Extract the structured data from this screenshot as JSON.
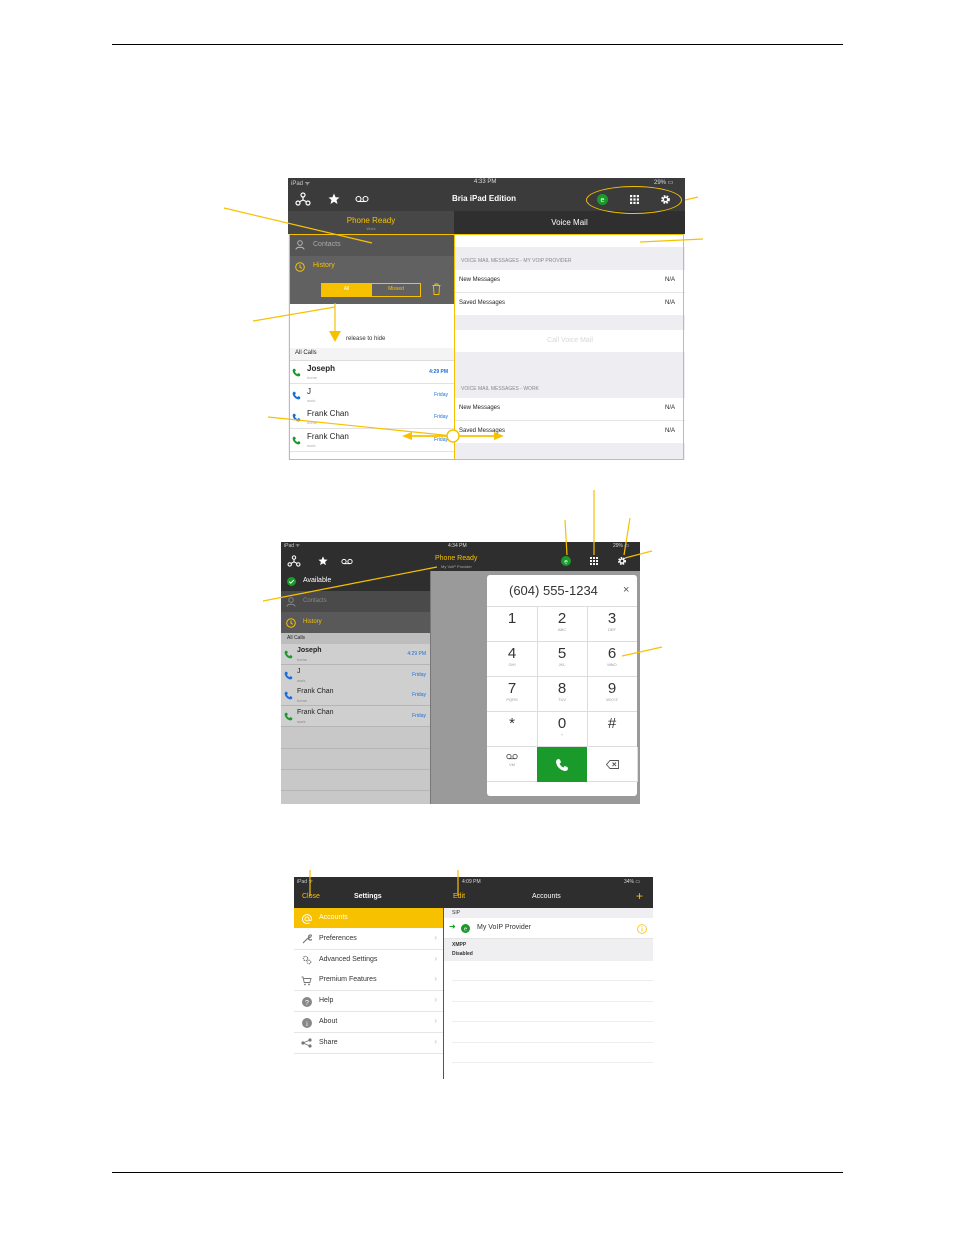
{
  "shot1": {
    "status": {
      "left": "iPad ᯤ",
      "time": "4:33 PM",
      "battery": "29% ▭"
    },
    "title": "Bria iPad Edition",
    "left_tab": {
      "label": "Phone Ready",
      "sub": "Work"
    },
    "right_tab": "Voice Mail",
    "contacts": "Contacts",
    "history": "History",
    "filter_all": "All",
    "filter_missed": "Missed",
    "release": "release to hide",
    "all_calls": "All Calls",
    "calls": [
      {
        "name": "Joseph",
        "sub": "home",
        "time": "4:29 PM"
      },
      {
        "name": "J",
        "sub": "work",
        "time": "Friday"
      },
      {
        "name": "Frank Chan",
        "sub": "home",
        "time": "Friday"
      },
      {
        "name": "Frank Chan",
        "sub": "work",
        "time": "Friday"
      }
    ],
    "vm_section1": "VOICE MAIL MESSAGES - MY VOIP PROVIDER",
    "vm_section2": "VOICE MAIL MESSAGES - WORK",
    "new_messages": "New Messages",
    "saved_messages": "Saved Messages",
    "na": "N/A",
    "call_voicemail": "Call Voice Mail"
  },
  "shot2": {
    "status": {
      "left": "iPad ᯤ",
      "time": "4:34 PM",
      "battery": "29% ▭"
    },
    "phone_ready": "Phone Ready",
    "phone_ready_sub": "My VoIP Provider",
    "available": "Available",
    "contacts": "Contacts",
    "history": "History",
    "all_calls": "All Calls",
    "calls": [
      {
        "name": "Joseph",
        "sub": "home",
        "time": "4:29 PM"
      },
      {
        "name": "J",
        "sub": "work",
        "time": "Friday"
      },
      {
        "name": "Frank Chan",
        "sub": "home",
        "time": "Friday"
      },
      {
        "name": "Frank Chan",
        "sub": "work",
        "time": "Friday"
      }
    ],
    "dial_number": "(604) 555-1234",
    "keys": [
      {
        "d": "1",
        "l": ""
      },
      {
        "d": "2",
        "l": "ABC"
      },
      {
        "d": "3",
        "l": "DEF"
      },
      {
        "d": "4",
        "l": "GHI"
      },
      {
        "d": "5",
        "l": "JKL"
      },
      {
        "d": "6",
        "l": "MNO"
      },
      {
        "d": "7",
        "l": "PQRS"
      },
      {
        "d": "8",
        "l": "TUV"
      },
      {
        "d": "9",
        "l": "WXYZ"
      },
      {
        "d": "*",
        "l": ""
      },
      {
        "d": "0",
        "l": "+"
      },
      {
        "d": "#",
        "l": ""
      }
    ],
    "vm_key": "VM"
  },
  "shot3": {
    "status_left": {
      "left": "iPad ᯤ",
      "time": "4:09 PM"
    },
    "status_right": {
      "battery": "34% ▭"
    },
    "close": "Close",
    "settings": "Settings",
    "menu": [
      "Accounts",
      "Preferences",
      "Advanced Settings",
      "Premium Features",
      "Help",
      "About",
      "Share"
    ],
    "edit": "Edit",
    "accounts": "Accounts",
    "plus": "+",
    "sip": "SIP",
    "provider": "My VoIP Provider",
    "xmpp": "XMPP",
    "disabled": "Disabled"
  },
  "colors": {
    "accent": "#f7c100",
    "dark": "#3b3b3b",
    "green": "#1a9a2a",
    "blue": "#1a6ed8"
  }
}
